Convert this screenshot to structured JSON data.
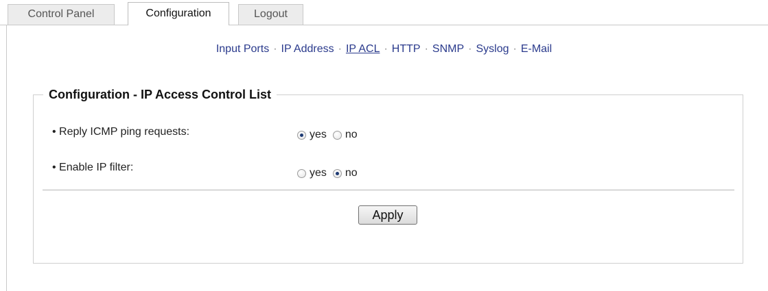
{
  "tabs": [
    {
      "label": "Control Panel"
    },
    {
      "label": "Configuration"
    },
    {
      "label": "Logout"
    }
  ],
  "subnav": [
    {
      "label": "Input Ports"
    },
    {
      "label": "IP Address"
    },
    {
      "label": "IP ACL"
    },
    {
      "label": "HTTP"
    },
    {
      "label": "SNMP"
    },
    {
      "label": "Syslog"
    },
    {
      "label": "E-Mail"
    }
  ],
  "subnav_separator": "·",
  "section": {
    "title": "Configuration - IP Access Control List",
    "rows": [
      {
        "label": "• Reply ICMP ping requests:",
        "yes": "yes",
        "no": "no",
        "selected": "yes"
      },
      {
        "label": "• Enable IP filter:",
        "yes": "yes",
        "no": "no",
        "selected": "no"
      }
    ],
    "apply_label": "Apply"
  }
}
